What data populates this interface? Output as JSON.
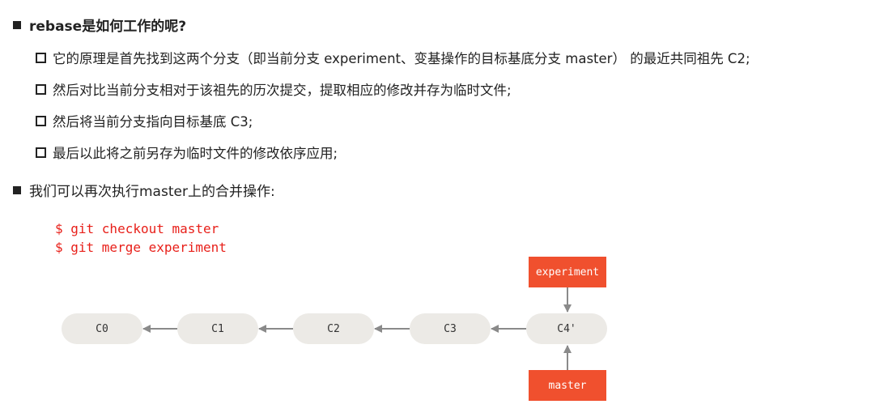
{
  "heading": "rebase是如何工作的呢?",
  "steps": [
    "它的原理是首先找到这两个分支（即当前分支 experiment、变基操作的目标基底分支 master） 的最近共同祖先 C2;",
    "然后对比当前分支相对于该祖先的历次提交，提取相应的修改并存为临时文件;",
    "然后将当前分支指向目标基底 C3;",
    "最后以此将之前另存为临时文件的修改依序应用;"
  ],
  "merge_note": "我们可以再次执行master上的合并操作:",
  "commands": [
    "$ git checkout master",
    "$ git merge experiment"
  ],
  "diagram": {
    "commits": [
      "C0",
      "C1",
      "C2",
      "C3",
      "C4'"
    ],
    "branch_top": "experiment",
    "branch_bottom": "master",
    "node_color": "#eceae6",
    "ref_color": "#f0502e",
    "arrow_color": "#8a8a8a"
  }
}
